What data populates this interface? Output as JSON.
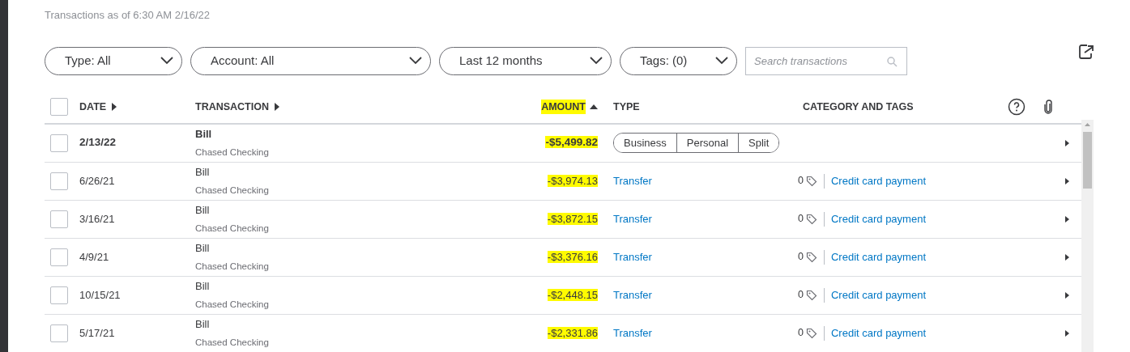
{
  "subtitle": "Transactions as of 6:30 AM 2/16/22",
  "filters": [
    {
      "label": "Type: All"
    },
    {
      "label": "Account: All"
    },
    {
      "label": "Last 12 months"
    },
    {
      "label": "Tags: (0)"
    }
  ],
  "search": {
    "placeholder": "Search transactions"
  },
  "select_all": {
    "checked": false
  },
  "columns": [
    {
      "label": "DATE",
      "kind": "sortable",
      "highlighted": false
    },
    {
      "label": "TRANSACTION",
      "kind": "sortable",
      "highlighted": false
    },
    {
      "label": "AMOUNT",
      "kind": "sorted",
      "highlighted": true
    },
    {
      "label": "TYPE",
      "kind": "plain",
      "highlighted": false
    },
    {
      "label": "CATEGORY AND TAGS",
      "kind": "plain",
      "highlighted": false
    }
  ],
  "rows": [
    {
      "kind": "pending",
      "checked": false,
      "date": "2/13/22",
      "payee": "Bill",
      "account": "Chased Checking",
      "amount": "-$5,499.82",
      "highlighted": true,
      "options": [
        {
          "label": "Business",
          "selected": false
        },
        {
          "label": "Personal",
          "selected": false
        },
        {
          "label": "Split",
          "selected": false
        }
      ]
    },
    {
      "kind": "categorized",
      "checked": false,
      "date": "6/26/21",
      "payee": "Bill",
      "account": "Chased Checking",
      "amount": "-$3,974.13",
      "highlighted": true,
      "type": "Transfer",
      "tag_count": "0",
      "category": "Credit card payment"
    },
    {
      "kind": "categorized",
      "checked": false,
      "date": "3/16/21",
      "payee": "Bill",
      "account": "Chased Checking",
      "amount": "-$3,872.15",
      "highlighted": true,
      "type": "Transfer",
      "tag_count": "0",
      "category": "Credit card payment"
    },
    {
      "kind": "categorized",
      "checked": false,
      "date": "4/9/21",
      "payee": "Bill",
      "account": "Chased Checking",
      "amount": "-$3,376.16",
      "highlighted": true,
      "type": "Transfer",
      "tag_count": "0",
      "category": "Credit card payment"
    },
    {
      "kind": "categorized",
      "checked": false,
      "date": "10/15/21",
      "payee": "Bill",
      "account": "Chased Checking",
      "amount": "-$2,448.15",
      "highlighted": true,
      "type": "Transfer",
      "tag_count": "0",
      "category": "Credit card payment"
    },
    {
      "kind": "categorized",
      "checked": false,
      "date": "5/17/21",
      "payee": "Bill",
      "account": "Chased Checking",
      "amount": "-$2,331.86",
      "highlighted": true,
      "type": "Transfer",
      "tag_count": "0",
      "category": "Credit card payment"
    }
  ]
}
